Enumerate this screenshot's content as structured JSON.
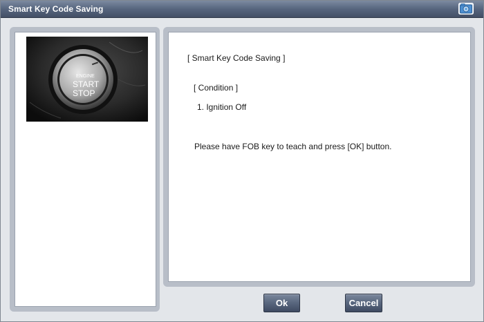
{
  "window": {
    "title": "Smart Key Code Saving",
    "title_icon": "camera-icon"
  },
  "image_panel": {
    "photo_icon": "engine-start-stop-button-photo",
    "photo_text": {
      "line1": "ENGINE",
      "line2": "START",
      "line3": "STOP"
    }
  },
  "content": {
    "heading": "[ Smart Key Code Saving ]",
    "condition_label": "[ Condition ]",
    "condition_item": "1. Ignition Off",
    "instruction": "Please have FOB key to teach and press [OK] button."
  },
  "buttons": {
    "ok_label": "Ok",
    "cancel_label": "Cancel"
  },
  "colors": {
    "titlebar": "#56657e",
    "panel_frame": "#b8bec8",
    "button": "#55637b"
  }
}
